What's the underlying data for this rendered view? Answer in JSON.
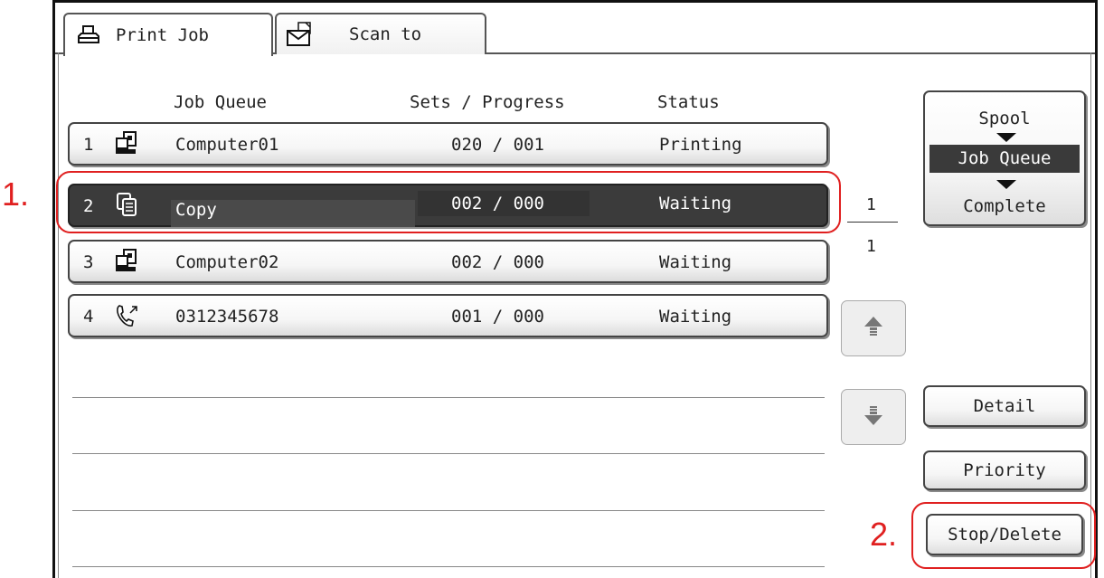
{
  "tabs": [
    {
      "label": "Print Job",
      "icon": "printer-icon",
      "active": true
    },
    {
      "label": "Scan to",
      "icon": "envelope-icon",
      "active": false
    }
  ],
  "columns": {
    "job_queue": "Job Queue",
    "sets_progress": "Sets / Progress",
    "status": "Status"
  },
  "jobs": [
    {
      "num": "1",
      "icon": "computer-icon",
      "name": "Computer01",
      "sets": "020 / 001",
      "status": "Printing",
      "selected": false
    },
    {
      "num": "2",
      "icon": "copy-icon",
      "name": "Copy",
      "sets": "002 / 000",
      "status": "Waiting",
      "selected": true
    },
    {
      "num": "3",
      "icon": "computer-icon",
      "name": "Computer02",
      "sets": "002 / 000",
      "status": "Waiting",
      "selected": false
    },
    {
      "num": "4",
      "icon": "fax-phone-icon",
      "name": "0312345678",
      "sets": "001 / 000",
      "status": "Waiting",
      "selected": false
    }
  ],
  "page": {
    "current": "1",
    "total": "1"
  },
  "queue_selector": {
    "spool": "Spool",
    "job_queue": "Job Queue",
    "complete": "Complete",
    "selected": "Job Queue"
  },
  "buttons": {
    "detail": "Detail",
    "priority": "Priority",
    "stop_delete": "Stop/Delete"
  },
  "annotations": {
    "label1": "1.",
    "label2": "2."
  },
  "colors": {
    "annotation": "#e02020",
    "selected_row": "#3b3b3b"
  }
}
